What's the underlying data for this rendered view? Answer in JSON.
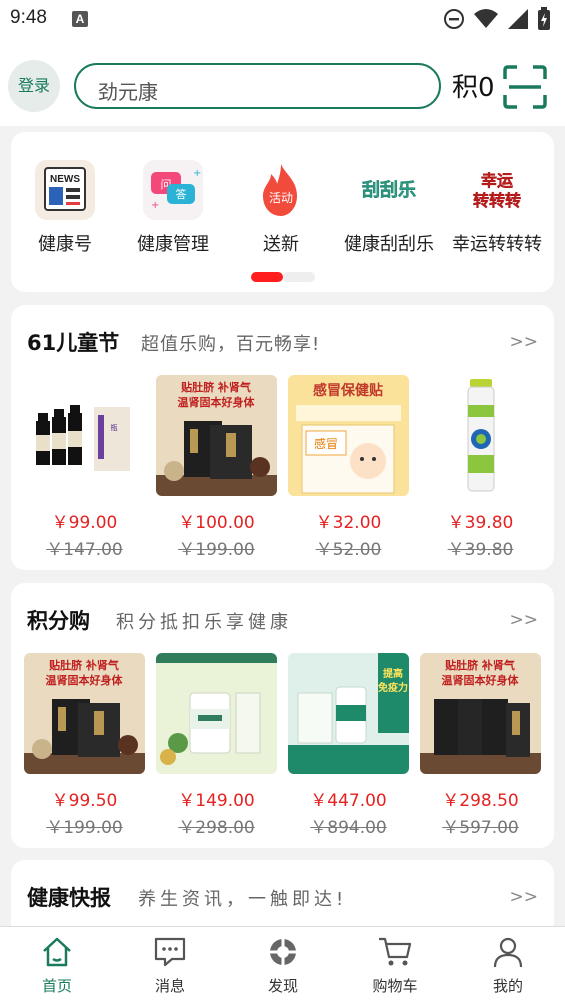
{
  "status": {
    "time": "9:48",
    "notif": "A"
  },
  "header": {
    "login": "登录",
    "search_value": "劲元康",
    "points_label": "积0"
  },
  "menu": [
    {
      "label": "健康号",
      "icon": "news-icon"
    },
    {
      "label": "健康管理",
      "icon": "qa-chat-icon"
    },
    {
      "label": "送新",
      "icon": "activity-flame-icon",
      "icon_text": "活动"
    },
    {
      "label": "健康刮刮乐",
      "icon": "scratch-card-icon",
      "icon_text": "刮刮乐"
    },
    {
      "label": "幸运转转转",
      "icon": "lucky-wheel-icon",
      "icon_text": "幸运转转转"
    }
  ],
  "sections": [
    {
      "title": "61儿童节",
      "subtitle": "超值乐购，百元畅享!",
      "more": ">>",
      "products": [
        {
          "price": "￥99.00",
          "orig": "￥147.00",
          "img_title": "",
          "color": "#ffffff"
        },
        {
          "price": "￥100.00",
          "orig": "￥199.00",
          "img_title": "贴肚脐 补肾气\n温肾固本好身体",
          "color": "#e9d9bd"
        },
        {
          "price": "￥32.00",
          "orig": "￥52.00",
          "img_title": "感冒保健贴",
          "color": "#fbe29b"
        },
        {
          "price": "￥39.80",
          "orig": "￥39.80",
          "img_title": "",
          "color": "#ffffff"
        }
      ]
    },
    {
      "title": "积分购",
      "subtitle": "积分抵扣乐享健康",
      "more": ">>",
      "products": [
        {
          "price": "￥99.50",
          "orig": "￥199.00",
          "img_title": "贴肚脐 补肾气\n温肾固本好身体",
          "color": "#e9d9bd"
        },
        {
          "price": "￥149.00",
          "orig": "￥298.00",
          "img_title": "",
          "color": "#eaf2d8"
        },
        {
          "price": "￥447.00",
          "orig": "￥894.00",
          "img_title": "提高免疫力",
          "color": "#dff0ea"
        },
        {
          "price": "￥298.50",
          "orig": "￥597.00",
          "img_title": "贴肚脐 补肾气\n温肾固本好身体",
          "color": "#e9d9bd"
        }
      ]
    },
    {
      "title": "健康快报",
      "subtitle": "养生资讯，一触即达!",
      "more": ">>"
    }
  ],
  "tabs": [
    {
      "label": "首页",
      "icon": "home-icon",
      "active": true
    },
    {
      "label": "消息",
      "icon": "message-icon"
    },
    {
      "label": "发现",
      "icon": "discover-icon"
    },
    {
      "label": "购物车",
      "icon": "cart-icon"
    },
    {
      "label": "我的",
      "icon": "user-icon"
    }
  ],
  "colors": {
    "brand": "#1a7a5e",
    "price": "#e52222",
    "dot": "#ff1e1e"
  }
}
